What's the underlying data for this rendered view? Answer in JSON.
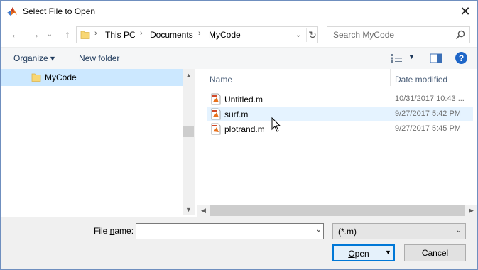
{
  "window": {
    "title": "Select File to Open",
    "close_glyph": "✕"
  },
  "nav": {
    "back_glyph": "←",
    "forward_glyph": "→",
    "recent_glyph": "⌄",
    "up_glyph": "↑",
    "breadcrumbs": [
      "This PC",
      "Documents",
      "MyCode"
    ],
    "crumb_sep": "›",
    "dropdown_glyph": "⌄",
    "refresh_glyph": "↻"
  },
  "search": {
    "placeholder": "Search MyCode"
  },
  "toolbar": {
    "organize_label": "Organize ▾",
    "new_folder_label": "New folder",
    "help_glyph": "?"
  },
  "tree": {
    "items": [
      {
        "label": "MyCode",
        "selected": true
      }
    ]
  },
  "columns": {
    "name": "Name",
    "date_modified": "Date modified"
  },
  "files": [
    {
      "name": "Untitled.m",
      "date": "10/31/2017 10:43 ...",
      "icon": "matlab-file-icon"
    },
    {
      "name": "surf.m",
      "date": "9/27/2017 5:42 PM",
      "icon": "matlab-file-icon",
      "hovered": true
    },
    {
      "name": "plotrand.m",
      "date": "9/27/2017 5:45 PM",
      "icon": "matlab-file-icon"
    }
  ],
  "footer": {
    "filename_label_pre": "File ",
    "filename_label_u": "n",
    "filename_label_post": "ame:",
    "filename_value": "",
    "filter_value": "(*.m)",
    "open_label_u": "O",
    "open_label_post": "pen",
    "cancel_label": "Cancel"
  },
  "colors": {
    "accent": "#0078d7",
    "selection": "#cce8ff",
    "hover": "#e5f3ff",
    "link": "#1e395b"
  }
}
